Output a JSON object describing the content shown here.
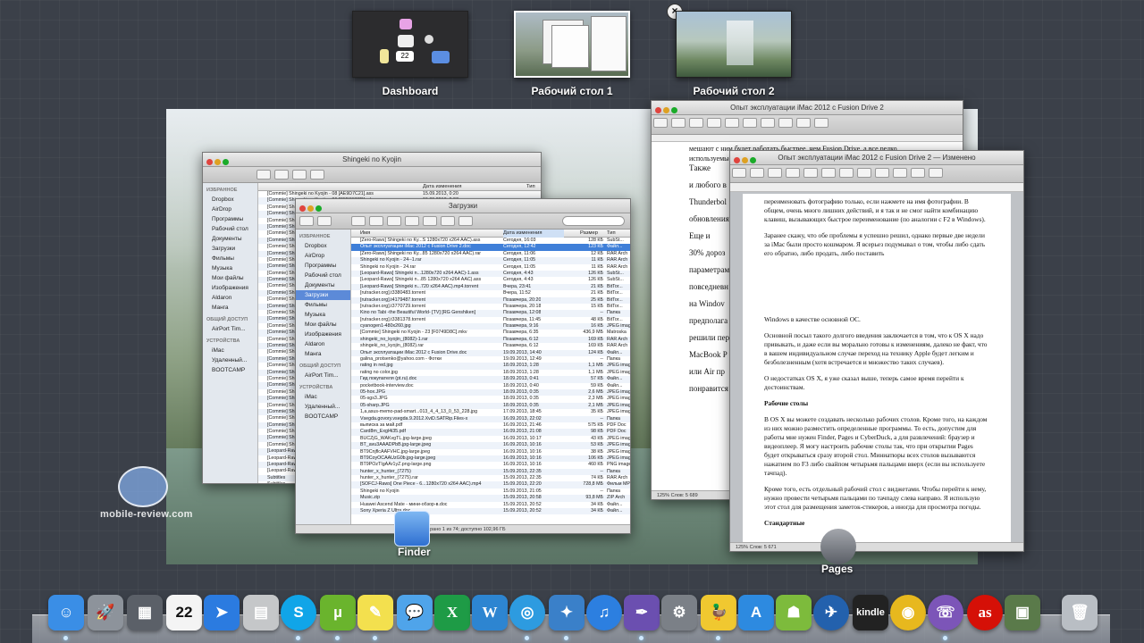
{
  "spaces": [
    {
      "label": "Dashboard"
    },
    {
      "label": "Рабочий стол 1"
    },
    {
      "label": "Рабочий стол 2"
    }
  ],
  "dashboard_widget_clock": "22",
  "close_space_glyph": "×",
  "finder_back": {
    "title": "Shingeki no Kyojin",
    "sidebar": [
      {
        "type": "section",
        "label": "ИЗБРАННОЕ"
      },
      {
        "type": "item",
        "label": "Dropbox"
      },
      {
        "type": "item",
        "label": "AirDrop"
      },
      {
        "type": "item",
        "label": "Программы"
      },
      {
        "type": "item",
        "label": "Рабочий стол"
      },
      {
        "type": "item",
        "label": "Документы"
      },
      {
        "type": "item",
        "label": "Загрузки"
      },
      {
        "type": "item",
        "label": "Фильмы"
      },
      {
        "type": "item",
        "label": "Музыка"
      },
      {
        "type": "item",
        "label": "Мои файлы"
      },
      {
        "type": "item",
        "label": "Изображения"
      },
      {
        "type": "item",
        "label": "Aldaron"
      },
      {
        "type": "item",
        "label": "Манга"
      },
      {
        "type": "section",
        "label": "ОБЩИЙ ДОСТУП"
      },
      {
        "type": "item",
        "label": "AirPort Tim..."
      },
      {
        "type": "section",
        "label": "УСТРОЙСТВА"
      },
      {
        "type": "item",
        "label": "iMac"
      },
      {
        "type": "item",
        "label": "Удаленный..."
      },
      {
        "type": "item",
        "label": "BOOTCAMP"
      }
    ],
    "rows": [
      {
        "name": "[Commie] Shingeki no Kyojin - 08 [AE9D7C21].ass",
        "date": "15.09.2013, 0:20"
      },
      {
        "name": "[Commie] Shingeki no Kyojin - 06 [9EB697CD].mkv",
        "date": "15.09.2013, 0:37"
      },
      {
        "name": "[Commie] Shingeki no Kyojin - 07 [9968960E7].ass",
        "date": "15.09.2013, 0:20"
      },
      {
        "name": "[Commie] Shingeki no Kyojin",
        "date": ""
      },
      {
        "name": "[Commie] Shingeki no Kyojin",
        "date": ""
      },
      {
        "name": "[Commie] Shingeki no Kyojin",
        "date": ""
      },
      {
        "name": "[Commie] Shingeki no Kyojin",
        "date": ""
      },
      {
        "name": "[Commie] Shingeki no Kyojin",
        "date": ""
      },
      {
        "name": "[Commie] Shingeki no Kyojin",
        "date": ""
      },
      {
        "name": "[Commie] Shingeki no Kyojin",
        "date": ""
      },
      {
        "name": "[Commie] Shingeki no Kyojin",
        "date": ""
      },
      {
        "name": "[Commie] Shingeki no Kyojin",
        "date": ""
      },
      {
        "name": "[Commie] Shingeki no Kyojin",
        "date": ""
      },
      {
        "name": "[Commie] Shingeki no Kyojin",
        "date": ""
      },
      {
        "name": "[Commie] Shingeki no Kyojin",
        "date": ""
      },
      {
        "name": "[Commie] Shingeki no Kyojin",
        "date": ""
      },
      {
        "name": "[Commie] Shingeki no Kyojin",
        "date": ""
      },
      {
        "name": "[Commie] Shingeki no Kyojin",
        "date": ""
      },
      {
        "name": "[Commie] Shingeki no Kyojin",
        "date": ""
      },
      {
        "name": "[Commie] Shingeki no Kyojin",
        "date": ""
      },
      {
        "name": "[Commie] Shingeki no Kyojin",
        "date": ""
      },
      {
        "name": "[Commie] Shingeki no Kyojin",
        "date": ""
      },
      {
        "name": "[Commie] Shingeki no Kyojin",
        "date": ""
      },
      {
        "name": "[Commie] Shingeki no Kyojin",
        "date": ""
      },
      {
        "name": "[Commie] Shingeki no Kyojin",
        "date": ""
      },
      {
        "name": "[Commie] Shingeki no Kyojin",
        "date": ""
      },
      {
        "name": "[Commie] Shingeki no Kyojin",
        "date": ""
      },
      {
        "name": "[Commie] Shingeki no Kyojin",
        "date": ""
      },
      {
        "name": "[Commie] Shingeki no Kyojin",
        "date": ""
      },
      {
        "name": "[Commie] Shingeki no Kyojin",
        "date": ""
      },
      {
        "name": "[Commie] Shingeki no Kyojin",
        "date": ""
      },
      {
        "name": "[Commie] Shingeki no Kyojin",
        "date": ""
      },
      {
        "name": "[Commie] Shingeki no Kyojin",
        "date": ""
      },
      {
        "name": "[Commie] Shingeki no Kyojin",
        "date": ""
      },
      {
        "name": "[Commie] Shingeki no Kyojin",
        "date": ""
      },
      {
        "name": "[Commie] Shingeki no Kyojin",
        "date": ""
      },
      {
        "name": "[Commie] Shingeki no Kyojin",
        "date": ""
      },
      {
        "name": "[Commie] Shingeki no Kyojin",
        "date": ""
      },
      {
        "name": "[Commie] Shingeki no Kyojin",
        "date": ""
      },
      {
        "name": "[Leopard-Raws] Shingeki no",
        "date": ""
      },
      {
        "name": "[Leopard-Raws] Shingeki no",
        "date": ""
      },
      {
        "name": "[Leopard-Raws] Shingeki no",
        "date": ""
      },
      {
        "name": "[Leopard-Raws] Shingeki no",
        "date": ""
      },
      {
        "name": "Subtitles",
        "date": ""
      },
      {
        "name": "Subtitles",
        "date": ""
      }
    ],
    "columns": {
      "date": "Дата изменения",
      "kind": "Тип"
    }
  },
  "finder_front": {
    "title": "Загрузки",
    "columns": {
      "name": "Имя",
      "date": "Дата изменения",
      "size": "Размер",
      "kind": "Тип"
    },
    "sidebar": [
      {
        "type": "section",
        "label": "ИЗБРАННОЕ"
      },
      {
        "type": "item",
        "label": "Dropbox"
      },
      {
        "type": "item",
        "label": "AirDrop"
      },
      {
        "type": "item",
        "label": "Программы"
      },
      {
        "type": "item",
        "label": "Рабочий стол"
      },
      {
        "type": "item",
        "label": "Документы"
      },
      {
        "type": "item",
        "label": "Загрузки",
        "selected": true
      },
      {
        "type": "item",
        "label": "Фильмы"
      },
      {
        "type": "item",
        "label": "Музыка"
      },
      {
        "type": "item",
        "label": "Мои файлы"
      },
      {
        "type": "item",
        "label": "Изображения"
      },
      {
        "type": "item",
        "label": "Aldaron"
      },
      {
        "type": "item",
        "label": "Манга"
      },
      {
        "type": "section",
        "label": "ОБЩИЙ ДОСТУП"
      },
      {
        "type": "item",
        "label": "AirPort Tim..."
      },
      {
        "type": "section",
        "label": "УСТРОЙСТВА"
      },
      {
        "type": "item",
        "label": "iMac"
      },
      {
        "type": "item",
        "label": "Удаленный..."
      },
      {
        "type": "item",
        "label": "BOOTCAMP"
      }
    ],
    "files": [
      {
        "name": "[Zero-Raws] Shingeki no Ky...S 1280x720 x264 AAC).ass",
        "date": "Сегодня, 16:03",
        "size": "128 КБ",
        "kind": "SubSt..."
      },
      {
        "name": "Опыт эксплуатации iMac 2012 с Fusion Drive 2.doc",
        "date": "Сегодня, 12:42",
        "size": "123 КБ",
        "kind": "Файл...",
        "selected": true
      },
      {
        "name": "[Zero-Raws] Shingeki no Ky...85 1280x720 x264 AAC).rar",
        "date": "Сегодня, 11:06",
        "size": "12 КБ",
        "kind": "RAR Arch"
      },
      {
        "name": "Shingeki no Kyojin - 24--1.rar",
        "date": "Сегодня, 11:05",
        "size": "11 КБ",
        "kind": "RAR Arch"
      },
      {
        "name": "Shingeki no Kyojin - 24.rar",
        "date": "Сегодня, 11:05",
        "size": "11 КБ",
        "kind": "RAR Arch"
      },
      {
        "name": "[Leopard-Raws] Shingeki n...1280x720 x264 AAC)-1.ass",
        "date": "Сегодня, 4:43",
        "size": "126 КБ",
        "kind": "SubSt..."
      },
      {
        "name": "[Leopard-Raws] Shingeki n...85 1280x720 x264 AAC).ass",
        "date": "Сегодня, 4:43",
        "size": "126 КБ",
        "kind": "SubSt..."
      },
      {
        "name": "[Leopard-Raws] Shingeki n...720 x264 AAC).mp4.torrent",
        "date": "Вчера, 23:41",
        "size": "21 КБ",
        "kind": "BitTor..."
      },
      {
        "name": "[rutracker.org].t3380483.torrent",
        "date": "Вчера, 11:52",
        "size": "21 КБ",
        "kind": "BitTor..."
      },
      {
        "name": "[rutracker.org].t4179487.torrent",
        "date": "Позавчера, 20:20",
        "size": "25 КБ",
        "kind": "BitTor..."
      },
      {
        "name": "[rutracker.org].t3770729.torrent",
        "date": "Позавчера, 20:18",
        "size": "15 КБ",
        "kind": "BitTor..."
      },
      {
        "name": "Kino no Tabi -the Beautiful World- [TV] [RG Genshiken]",
        "date": "Позавчера, 12:08",
        "size": "--",
        "kind": "Папка"
      },
      {
        "name": "[rutracker.org].t3381378.torrent",
        "date": "Позавчера, 11:45",
        "size": "48 КБ",
        "kind": "BitTor..."
      },
      {
        "name": "cyanogen1-480x260.jpg",
        "date": "Позавчера, 9:16",
        "size": "16 КБ",
        "kind": "JPEG image"
      },
      {
        "name": "[Commie] Shingeki no Kyojin - 23 [F0749D8C].mkv",
        "date": "Позавчера, 6:35",
        "size": "436,9 МБ",
        "kind": "Matroska"
      },
      {
        "name": "shingeki_no_kyojin_(8082)-1.rar",
        "date": "Позавчера, 6:12",
        "size": "169 КБ",
        "kind": "RAR Arch"
      },
      {
        "name": "shingeki_no_kyojin_(8082).rar",
        "date": "Позавчера, 6:12",
        "size": "169 КБ",
        "kind": "RAR Arch"
      },
      {
        "name": "Опыт эксплуатации iMac 2012 с Fusion Drive.doc",
        "date": "19.09.2013, 14:40",
        "size": "124 КБ",
        "kind": "Файл..."
      },
      {
        "name": "galina_protsenko@yahoo.com - Фотки",
        "date": "19.09.2013, 12:49",
        "size": "--",
        "kind": "Папка"
      },
      {
        "name": "rating in red.jpg",
        "date": "18.09.2013, 1:28",
        "size": "1,1 МБ",
        "kind": "JPEG image"
      },
      {
        "name": "rating no color.jpg",
        "date": "18.09.2013, 1:28",
        "size": "1,1 МБ",
        "kind": "JPEG image"
      },
      {
        "name": "Гид покупателя (pt.ru).doc",
        "date": "18.09.2013, 0:41",
        "size": "57 КБ",
        "kind": "Файл..."
      },
      {
        "name": "pocketbook-interview.doc",
        "date": "18.09.2013, 0:40",
        "size": "59 КБ",
        "kind": "Файл..."
      },
      {
        "name": "05-hox.JPG",
        "date": "18.09.2013, 0:35",
        "size": "2,6 МБ",
        "kind": "JPEG image"
      },
      {
        "name": "05-sgs3.JPG",
        "date": "18.09.2013, 0:35",
        "size": "2,3 МБ",
        "kind": "JPEG image"
      },
      {
        "name": "05-sharp.JPG",
        "date": "18.09.2013, 0:35",
        "size": "2,1 МБ",
        "kind": "JPEG image"
      },
      {
        "name": "1,a,asus-memo-pad-smart...013_4_4_13_0_53_228.jpg",
        "date": "17.09.2013, 18:45",
        "size": "35 КБ",
        "kind": "JPEG image"
      },
      {
        "name": "Vsegda.govory.vsegda.9.2012.XviD.SATRip.Files-x",
        "date": "16.09.2013, 22:02",
        "size": "--",
        "kind": "Папка"
      },
      {
        "name": "выписка за май.pdf",
        "date": "16.09.2013, 21:46",
        "size": "575 КБ",
        "kind": "PDF Doc"
      },
      {
        "name": "Card8m_Exgl4i35.pdf",
        "date": "16.09.2013, 21:08",
        "size": "98 КБ",
        "kind": "PDF Doc"
      },
      {
        "name": "BUCZjG_WAKvgTL.jpg-large.jpeg",
        "date": "16.09.2013, 10:17",
        "size": "43 КБ",
        "kind": "JPEG image"
      },
      {
        "name": "BT_avu3AAADPbB.jpg-large.jpeg",
        "date": "16.09.2013, 10:16",
        "size": "53 КБ",
        "kind": "JPEG image"
      },
      {
        "name": "BT9CnjflcAAFVHC.jpg-large.jpeg",
        "date": "16.09.2013, 10:16",
        "size": "38 КБ",
        "kind": "JPEG image"
      },
      {
        "name": "BT9CoyOCAAUzG0b.jpg-large.jpeg",
        "date": "16.09.2013, 10:16",
        "size": "106 КБ",
        "kind": "JPEG image"
      },
      {
        "name": "BT9POzTIgAAr1yZ.png-large.png",
        "date": "16.09.2013, 10:16",
        "size": "460 КБ",
        "kind": "PNG image"
      },
      {
        "name": "hunter_x_hunter_(7275)",
        "date": "15.09.2013, 22:35",
        "size": "--",
        "kind": "Папка"
      },
      {
        "name": "hunter_x_hunter_(7275).rar",
        "date": "15.09.2013, 22:35",
        "size": "74 КБ",
        "kind": "RAR Arch"
      },
      {
        "name": "[SOFCJ-Raws] One Piece - 6...1280x720 x264 AAC).mp4",
        "date": "15.09.2013, 22:20",
        "size": "728,8 МБ",
        "kind": "Фильм MP"
      },
      {
        "name": "Shingeki no Kyojin",
        "date": "15.09.2013, 21:05",
        "size": "--",
        "kind": "Папка"
      },
      {
        "name": "Music.zip",
        "date": "15.09.2013, 20:58",
        "size": "93,8 МБ",
        "kind": "ZIP Arch"
      },
      {
        "name": "Huawei Ascend Mate - мини-обзор-в.doc",
        "date": "15.09.2013, 20:52",
        "size": "34 КБ",
        "kind": "Файл..."
      },
      {
        "name": "Sony Xperia Z Ultra.doc",
        "date": "15.09.2013, 20:52",
        "size": "34 КБ",
        "kind": "Файл..."
      }
    ],
    "status": "Выбрано 1 из 74; доступно 102,96 ГБ"
  },
  "pages_back": {
    "title": "Опыт эксплуатации iMac 2012 с Fusion Drive 2",
    "visible_text": [
      "Тaкже",
      "и любого в",
      "Thunderbol",
      "обновления",
      "Еще и",
      "30% дороз",
      "параметрам",
      "повседневн",
      "на Windov",
      "предполага",
      "решили пер",
      "MacBook P",
      "или Air пр",
      "понравится"
    ],
    "lead_text": "мешают с ним будет работать быстрее, чем Fusion Drive, а все редко используемые данные можно хранить на внешнем диске.",
    "status": "125%  Слов: 5 689"
  },
  "pages_front": {
    "title": "Опыт эксплуатации iMac 2012 с Fusion Drive 2 — Изменено",
    "top_paragraphs": [
      "переименовать фотографию только, если нажмете на имя фотографии. В общем, очень много лишних действий, и я так и не смог найти комбинацию клавиш, вызывающих быстрое переименование (по аналогии с F2 в Windows).",
      "Заранее скажу, что обе проблемы я успешно решил, однако первые две недели за iMac были просто кошмаром. Я всерьез подумывал о том, чтобы либо сдать его обратно, либо продать, либо поставить"
    ],
    "page_paragraphs": [
      {
        "bold": false,
        "text": "Windows в качестве основной ОС."
      },
      {
        "bold": false,
        "text": "Основной посыл такого долгого введения заключается в том, что к OS X надо привыкать, и даже если вы морально готовы к изменениям, далеко не факт, что в вашем индивидуальном случае переход на технику Apple будет легким и безболезненным (хотя встречается и множество таких случаев)."
      },
      {
        "bold": false,
        "text": "О недостатках OS X, я уже сказал выше, теперь самое время перейти к достоинствам."
      },
      {
        "bold": true,
        "text": "Рабочие столы"
      },
      {
        "bold": false,
        "text": "В OS X вы можете создавать несколько рабочих столов. Кроме того, на каждом из них можно разместить определенные программы. То есть, допустим для работы мне нужен Finder, Pages и CyberDuck, а для развлечений: браузер и видеоплеер. Я могу настроить рабочие столы так, что при открытии Pages будет открываться сразу второй стол. Миниатюры всех столов вызываются нажатием по F3 либо свайпом четырьмя пальцами вверх (если вы используете тачпад)."
      },
      {
        "bold": false,
        "text": "Кроме того, есть отдельный рабочий стол с виджетами. Чтобы перейти к нему, нужно провести четырьмя пальцами по тачпаду слева направо. Я использую этот стол для размещения заметок-стикеров, а иногда для просмотра погоды."
      },
      {
        "bold": true,
        "text": "Стандартные"
      }
    ],
    "status": "125%  Слов: 5 671"
  },
  "app_labels": {
    "finder": "Finder",
    "pages": "Pages"
  },
  "watermark": "mobile-review.com",
  "dock": [
    {
      "name": "finder",
      "color": "#3a8ee6",
      "glyph": "☺"
    },
    {
      "name": "launchpad",
      "color": "#8d939b",
      "glyph": "🚀"
    },
    {
      "name": "dashboard",
      "color": "#5b6068",
      "glyph": "▦"
    },
    {
      "name": "calendar",
      "color": "#f4f4f4",
      "glyph": "22"
    },
    {
      "name": "mail-airmail",
      "color": "#2b7be0",
      "glyph": "➤"
    },
    {
      "name": "calculator",
      "color": "#c5c7c9",
      "glyph": "▤"
    },
    {
      "name": "skype",
      "color": "#10a5e8",
      "glyph": "S"
    },
    {
      "name": "utorrent",
      "color": "#6ab42d",
      "glyph": "µ"
    },
    {
      "name": "stickies",
      "color": "#f3e04e",
      "glyph": "✎"
    },
    {
      "name": "messages",
      "color": "#4fa4ea",
      "glyph": "💬"
    },
    {
      "name": "excel",
      "color": "#1e9b46",
      "glyph": "X"
    },
    {
      "name": "word",
      "color": "#2d85d1",
      "glyph": "W"
    },
    {
      "name": "safari",
      "color": "#2d9be0",
      "glyph": "◎"
    },
    {
      "name": "tweetbot",
      "color": "#3a80c9",
      "glyph": "✦"
    },
    {
      "name": "itunes",
      "color": "#2c7fe0",
      "glyph": "♫"
    },
    {
      "name": "pages",
      "color": "#6b4fb0",
      "glyph": "✒"
    },
    {
      "name": "preview",
      "color": "#7b8087",
      "glyph": "⚙"
    },
    {
      "name": "cyberduck",
      "color": "#f0c830",
      "glyph": "🦆"
    },
    {
      "name": "app-store",
      "color": "#2d8ae0",
      "glyph": "A"
    },
    {
      "name": "android-transfer",
      "color": "#7dbb3c",
      "glyph": "☗"
    },
    {
      "name": "network-radar",
      "color": "#2361ad",
      "glyph": "✈"
    },
    {
      "name": "kindle",
      "color": "#222222",
      "glyph": "kindle"
    },
    {
      "name": "chrome-canary",
      "color": "#e7b81e",
      "glyph": "◉"
    },
    {
      "name": "viber",
      "color": "#7c55b8",
      "glyph": "☏"
    },
    {
      "name": "lastfm",
      "color": "#d51007",
      "glyph": "as"
    },
    {
      "name": "iphoto",
      "color": "#5a7a4a",
      "glyph": "▣"
    },
    {
      "name": "trash",
      "color": "#b9bec4",
      "glyph": "🗑"
    }
  ]
}
